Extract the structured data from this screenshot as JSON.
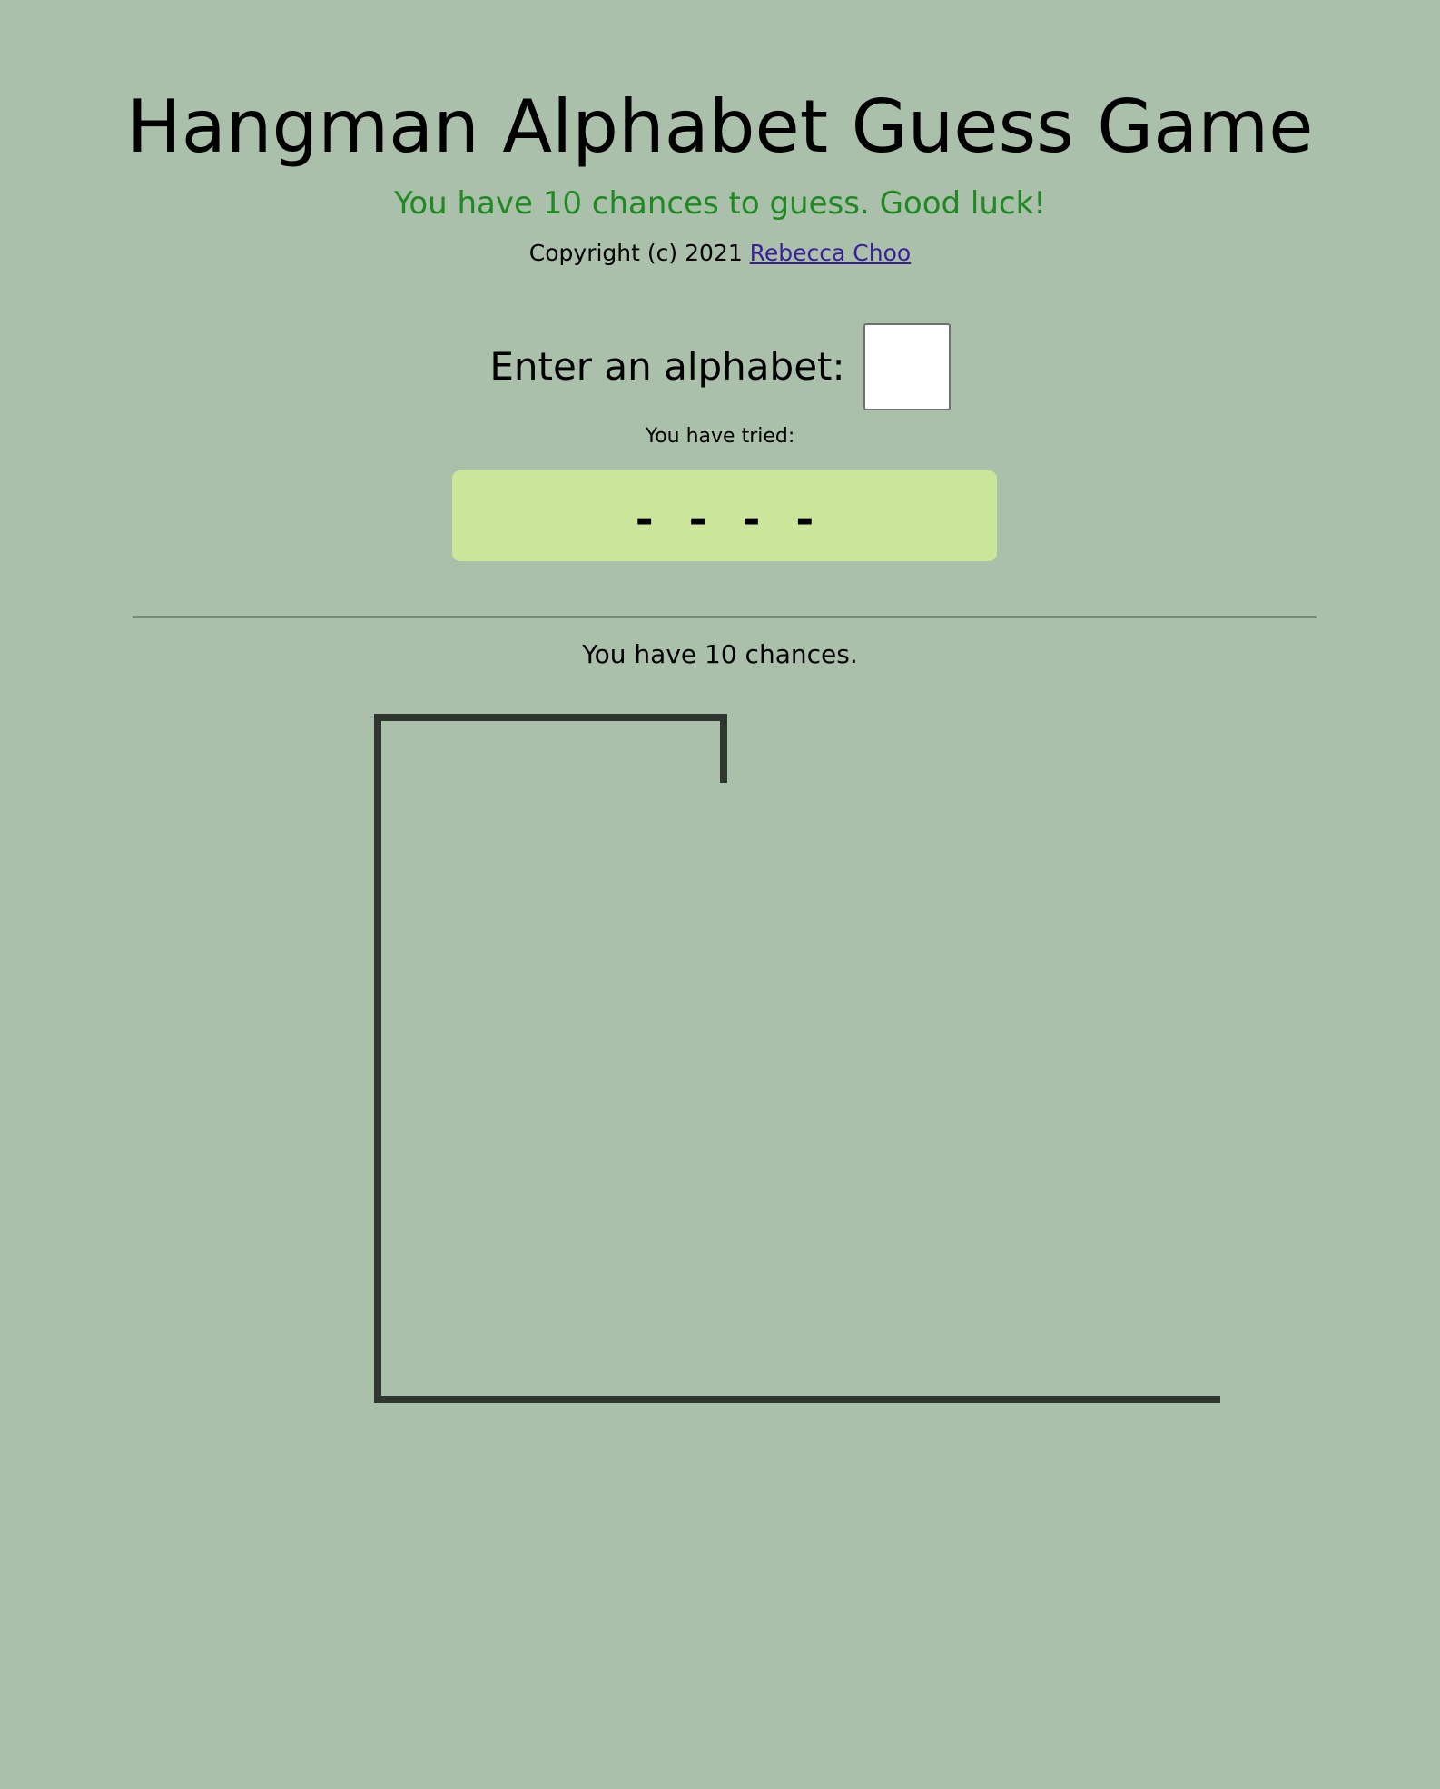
{
  "header": {
    "title": "Hangman Alphabet Guess Game",
    "subtitle": "You have 10 chances to guess. Good luck!",
    "copyright_prefix": "Copyright (c) 2021 ",
    "author_link": "Rebecca Choo"
  },
  "guess": {
    "label": "Enter an alphabet:",
    "value": ""
  },
  "tried": {
    "label": "You have tried:"
  },
  "word": {
    "slots": [
      "-",
      "-",
      "-",
      "-"
    ]
  },
  "status": {
    "chances_text": "You have 10 chances."
  },
  "gallows": {
    "stroke_color": "#2f362f"
  }
}
